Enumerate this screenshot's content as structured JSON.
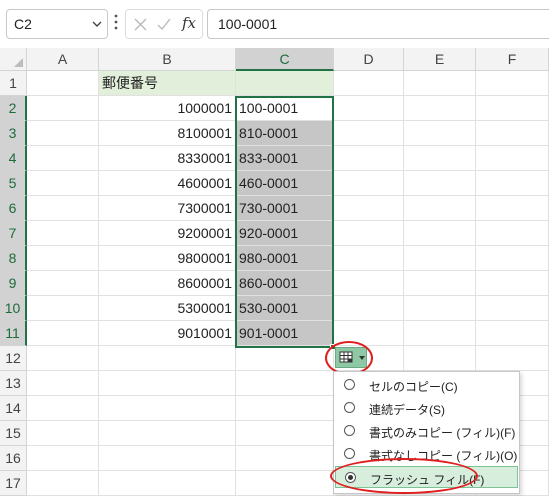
{
  "formula_bar": {
    "name_box": "C2",
    "fx_label": "fx",
    "formula": "100-0001"
  },
  "columns": [
    "A",
    "B",
    "C",
    "D",
    "E",
    "F"
  ],
  "selected_column": "C",
  "rows": [
    "1",
    "2",
    "3",
    "4",
    "5",
    "6",
    "7",
    "8",
    "9",
    "10",
    "11",
    "12",
    "13",
    "14",
    "15",
    "16",
    "17"
  ],
  "header_cell": "郵便番号",
  "data": [
    {
      "b": "1000001",
      "c": "100-0001"
    },
    {
      "b": "8100001",
      "c": "810-0001"
    },
    {
      "b": "8330001",
      "c": "833-0001"
    },
    {
      "b": "4600001",
      "c": "460-0001"
    },
    {
      "b": "7300001",
      "c": "730-0001"
    },
    {
      "b": "9200001",
      "c": "920-0001"
    },
    {
      "b": "9800001",
      "c": "980-0001"
    },
    {
      "b": "8600001",
      "c": "860-0001"
    },
    {
      "b": "5300001",
      "c": "530-0001"
    },
    {
      "b": "9010001",
      "c": "901-0001"
    }
  ],
  "autofill_menu": {
    "items": [
      {
        "label": "セルのコピー(C)",
        "checked": false
      },
      {
        "label": "連続データ(S)",
        "checked": false
      },
      {
        "label": "書式のみコピー (フィル)(F)",
        "checked": false
      },
      {
        "label": "書式なしコピー (フィル)(O)",
        "checked": false
      },
      {
        "label": "フラッシュ フィル(F)",
        "checked": true
      }
    ]
  },
  "colors": {
    "accent": "#217346",
    "header_fill": "#e2efda",
    "filled_cells": "#c6c6c6",
    "highlight_circle": "#e01e1e"
  }
}
